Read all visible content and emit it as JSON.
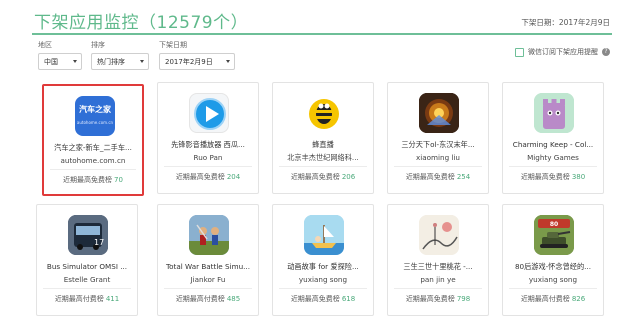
{
  "header": {
    "title": "下架应用监控（12579个）",
    "date": "下架日期：2017年2月9日"
  },
  "filters": [
    {
      "label": "地区",
      "value": "中国"
    },
    {
      "label": "排序",
      "value": "热门排序"
    },
    {
      "label": "下架日期",
      "value": "2017年2月9日"
    }
  ],
  "subscribe": {
    "label": "微信订阅下架应用提醒",
    "help": "?"
  },
  "cards": [
    {
      "name": "汽车之家-新车_二手车...",
      "developer": "autohome.com.cn",
      "rank_label": "近期最高免费榜",
      "rank": "70",
      "icon": "autohome-icon",
      "icon_text": "汽车之家",
      "icon_subtext": "autohome.com.cn",
      "highlight": true
    },
    {
      "name": "先锋影音播放器 西瓜...",
      "developer": "Ruo Pan",
      "rank_label": "近期最高免费榜",
      "rank": "204",
      "icon": "play-button-icon"
    },
    {
      "name": "蜂直播",
      "developer": "北京丰杰世纪网络科...",
      "rank_label": "近期最高免费榜",
      "rank": "206",
      "icon": "bee-icon"
    },
    {
      "name": "三分天下ol-东汉末年...",
      "developer": "xiaoming liu",
      "rank_label": "近期最高免费榜",
      "rank": "254",
      "icon": "three-kingdoms-game-icon"
    },
    {
      "name": "Charming Keep - Col...",
      "developer": "Mighty Games",
      "rank_label": "近期最高免费榜",
      "rank": "380",
      "icon": "castle-character-icon"
    },
    {
      "name": "Bus Simulator OMSI ...",
      "developer": "Estelle Grant",
      "rank_label": "近期最高付费榜",
      "rank": "411",
      "icon": "bus-icon"
    },
    {
      "name": "Total War Battle Simu...",
      "developer": "Jiankor Fu",
      "rank_label": "近期最高付费榜",
      "rank": "485",
      "icon": "battle-soldiers-icon"
    },
    {
      "name": "动画故事 for 爱探险...",
      "developer": "yuxiang song",
      "rank_label": "近期最高免费榜",
      "rank": "618",
      "icon": "cartoon-boat-icon"
    },
    {
      "name": "三生三世十里桃花 -...",
      "developer": "pan jin ye",
      "rank_label": "近期最高免费榜",
      "rank": "798",
      "icon": "ink-painting-icon"
    },
    {
      "name": "80后游戏-怀念曾经的...",
      "developer": "yuxiang song",
      "rank_label": "近期最高付费榜",
      "rank": "826",
      "icon": "tank-game-icon"
    }
  ]
}
